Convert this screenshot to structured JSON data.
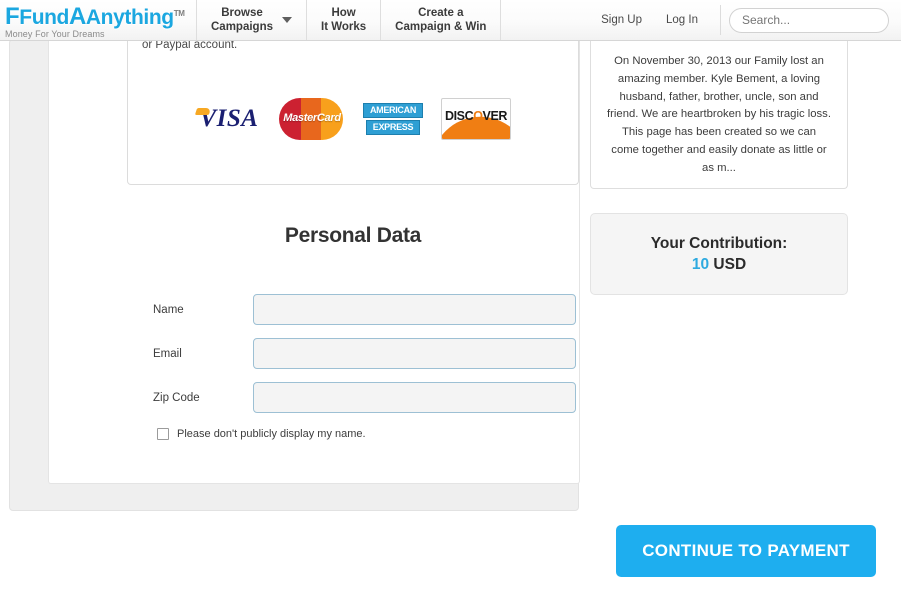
{
  "header": {
    "logo": {
      "name_part1": "Fund",
      "name_part2": "Anything",
      "tm": "TM",
      "tagline": "Money For Your Dreams"
    },
    "nav": [
      {
        "line1": "Browse",
        "line2": "Campaigns",
        "has_caret": true
      },
      {
        "line1": "How",
        "line2": "It Works",
        "has_caret": false
      },
      {
        "line1": "Create a",
        "line2": "Campaign & Win",
        "has_caret": false
      }
    ],
    "sign_up": "Sign Up",
    "log_in": "Log In",
    "search_placeholder": "Search...",
    "search_value": ""
  },
  "payment": {
    "lead_text": "or Paypal account.",
    "cards": [
      {
        "name": "visa",
        "label": "VISA"
      },
      {
        "name": "mastercard",
        "label": "MasterCard"
      },
      {
        "name": "american-express",
        "line1": "AMERICAN",
        "line2": "EXPRESS"
      },
      {
        "name": "discover",
        "pre": "DISC",
        "dot": "O",
        "post": "VER"
      }
    ]
  },
  "personal_data": {
    "title": "Personal Data",
    "fields": [
      {
        "label": "Name",
        "value": "",
        "placeholder": ""
      },
      {
        "label": "Email",
        "value": "",
        "placeholder": ""
      },
      {
        "label": "Zip Code",
        "value": "",
        "placeholder": ""
      }
    ],
    "privacy_checkbox_label": "Please don't publicly display my name.",
    "privacy_checked": false
  },
  "campaign": {
    "description": "On November 30, 2013 our Family lost an amazing member. Kyle Bement, a loving husband, father, brother, uncle, son and friend. We are heartbroken by his tragic loss. This page has been created so we can come together and easily donate as little or as m..."
  },
  "contribution": {
    "title": "Your Contribution:",
    "amount": "10",
    "currency": "USD"
  },
  "cta": {
    "label": "CONTINUE TO PAYMENT"
  },
  "colors": {
    "brand_blue": "#1ba7e0",
    "cta_blue": "#1eaeef",
    "amount_blue": "#2eaae0",
    "visa_navy": "#1a1f71",
    "mastercard_red": "#cc2131",
    "mastercard_yellow": "#f8a01c",
    "amex_blue": "#2e9fd4",
    "discover_orange": "#f07e13"
  }
}
